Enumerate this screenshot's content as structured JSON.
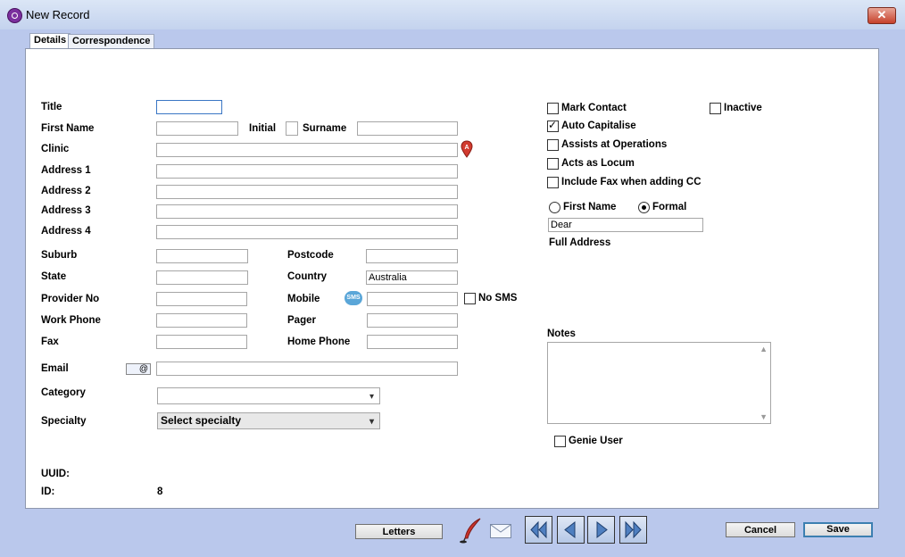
{
  "window": {
    "title": "New Record",
    "close_label": "✕"
  },
  "tabs": [
    {
      "label": "Details"
    },
    {
      "label": "Correspondence"
    }
  ],
  "form": {
    "title_label": "Title",
    "first_name_label": "First Name",
    "initial_label": "Initial",
    "surname_label": "Surname",
    "clinic_label": "Clinic",
    "address1_label": "Address 1",
    "address2_label": "Address 2",
    "address3_label": "Address 3",
    "address4_label": "Address 4",
    "suburb_label": "Suburb",
    "postcode_label": "Postcode",
    "state_label": "State",
    "country_label": "Country",
    "country_value": "Australia",
    "provider_label": "Provider No",
    "mobile_label": "Mobile",
    "no_sms_label": "No SMS",
    "work_phone_label": "Work Phone",
    "pager_label": "Pager",
    "fax_label": "Fax",
    "home_phone_label": "Home Phone",
    "email_label": "Email",
    "category_label": "Category",
    "specialty_label": "Specialty",
    "specialty_value": "Select specialty",
    "uuid_label": "UUID:",
    "id_label": "ID:",
    "id_value": "8",
    "sms_icon_text": "SMS",
    "email_icon_text": "@"
  },
  "options": {
    "mark_contact": {
      "label": "Mark Contact",
      "checked": false
    },
    "inactive": {
      "label": "Inactive",
      "checked": false
    },
    "auto_capitalise": {
      "label": "Auto Capitalise",
      "checked": true
    },
    "assists_ops": {
      "label": "Assists at Operations",
      "checked": false
    },
    "acts_locum": {
      "label": "Acts as Locum",
      "checked": false
    },
    "include_fax": {
      "label": "Include Fax when adding CC",
      "checked": false
    },
    "salutation_first": {
      "label": "First Name",
      "selected": false
    },
    "salutation_formal": {
      "label": "Formal",
      "selected": true
    },
    "salutation_value": "Dear",
    "full_address_label": "Full Address",
    "notes_label": "Notes",
    "genie_user": {
      "label": "Genie User",
      "checked": false
    }
  },
  "footer": {
    "letters_label": "Letters",
    "cancel_label": "Cancel",
    "save_label": "Save"
  },
  "colors": {
    "panel_bg": "#bac8ec",
    "accent": "#3c7fb1"
  }
}
